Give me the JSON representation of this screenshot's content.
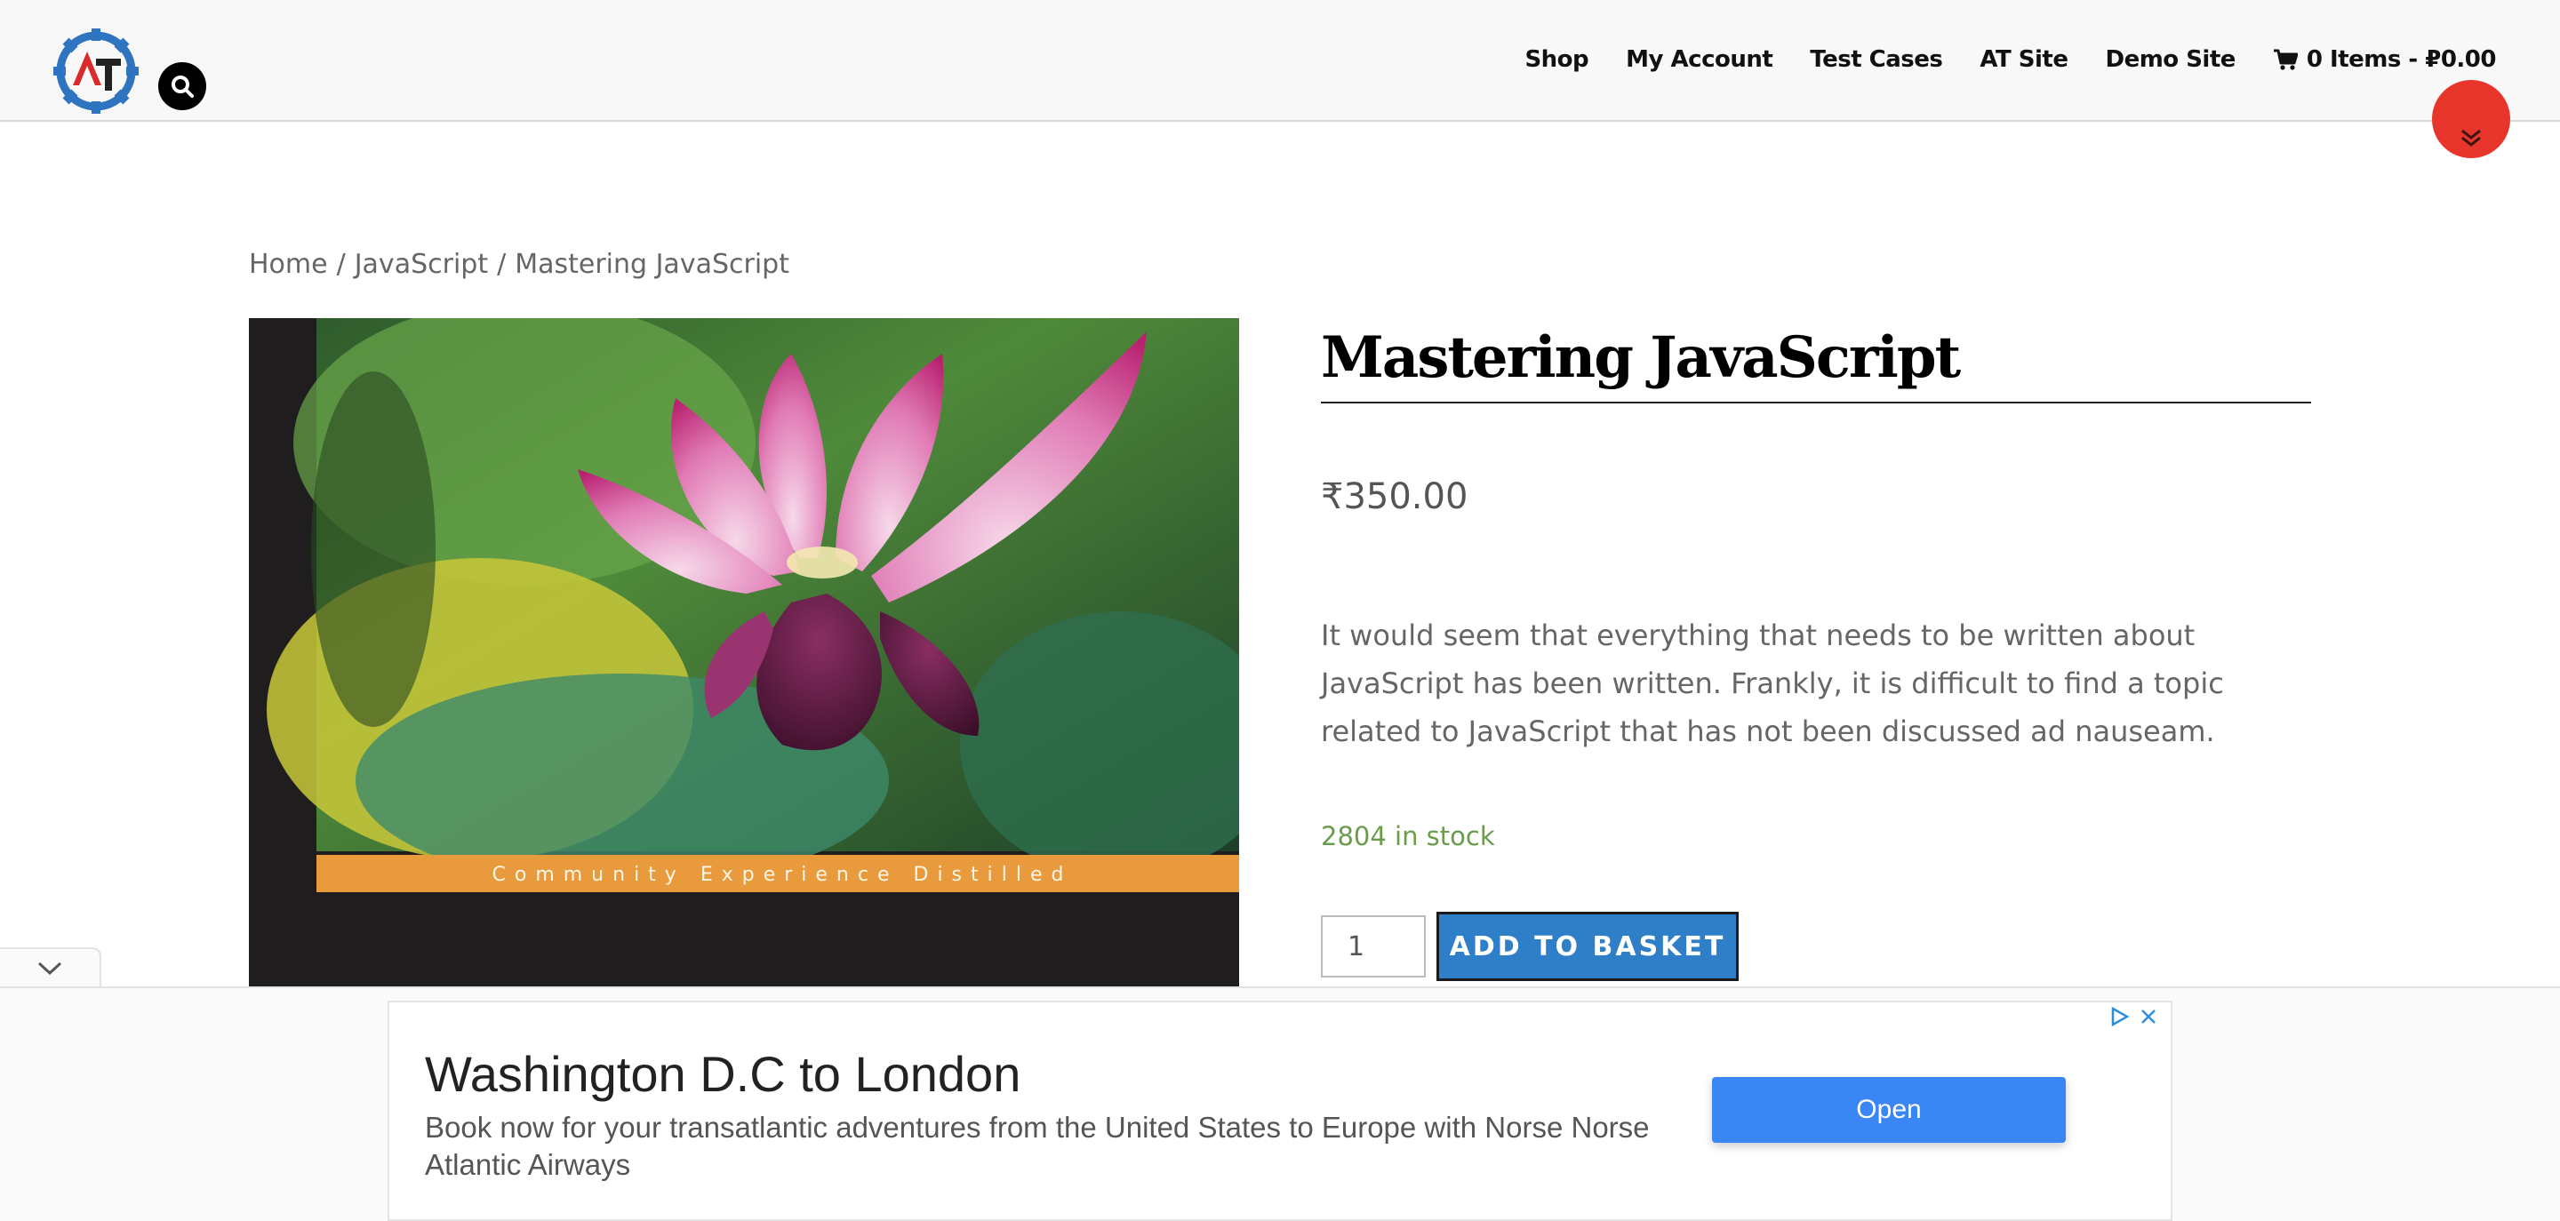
{
  "header": {
    "logo_letters": "AT",
    "nav": [
      {
        "label": "Shop"
      },
      {
        "label": "My Account"
      },
      {
        "label": "Test Cases"
      },
      {
        "label": "AT Site"
      },
      {
        "label": "Demo Site"
      }
    ],
    "cart_label": "0 Items - ₽0.00"
  },
  "breadcrumb": {
    "home": "Home",
    "category": "JavaScript",
    "current": "Mastering JavaScript",
    "separator": "/"
  },
  "product": {
    "image_banner_text": "Community Experience Distilled",
    "title": "Mastering JavaScript",
    "price": "₹350.00",
    "description": "It would seem that everything that needs to be written about JavaScript has been written. Frankly, it is difficult to find a topic related to JavaScript that has not been discussed ad nauseam.",
    "stock": "2804 in stock",
    "quantity": "1",
    "add_to_basket": "ADD TO BASKET"
  },
  "ad": {
    "title": "Washington D.C to London",
    "text": "Book now for your transatlantic adventures from the United States to Europe with Norse Norse Atlantic Airways",
    "open_label": "Open"
  },
  "colors": {
    "accent": "#2f7ec8",
    "scroll_button": "#e7352b",
    "stock_green": "#6a9c4b",
    "ad_button": "#3a86f5"
  },
  "icons": [
    "gear-logo-icon",
    "search-icon",
    "cart-icon",
    "double-chevron-down-icon",
    "chevron-down-icon",
    "adchoices-icon",
    "close-icon"
  ]
}
